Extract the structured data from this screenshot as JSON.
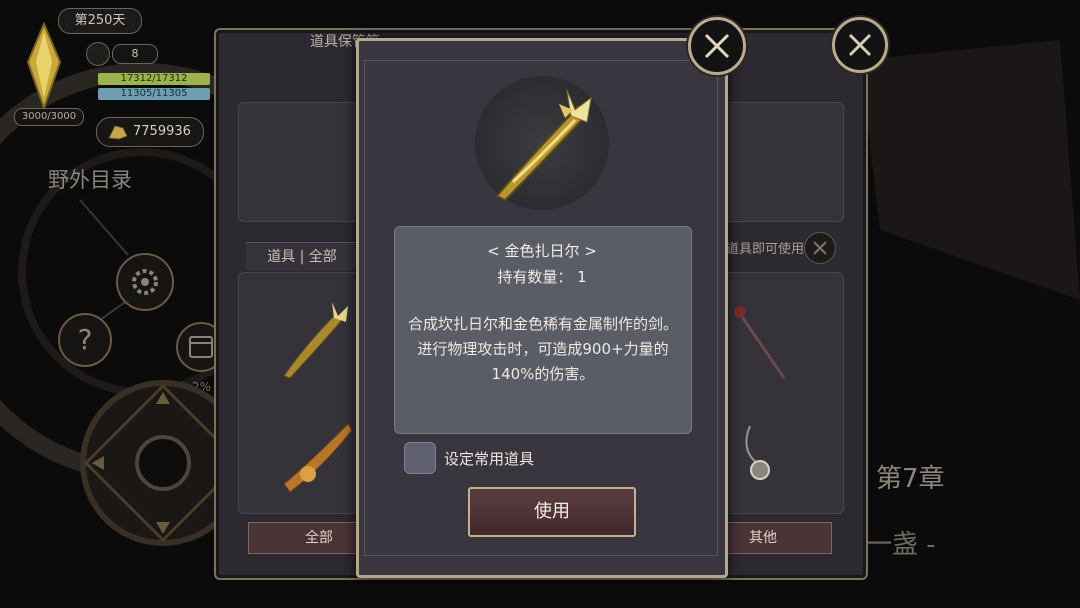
{
  "hud": {
    "day": "第250天",
    "calendar_count": "8",
    "hp": "17312/17312",
    "mp": "11305/11305",
    "stamina": "3000/3000",
    "gold": "7759936",
    "field_menu": "野外目录",
    "help": "?",
    "progress": "2%",
    "chapter": "第7章",
    "chapter_sub": "后一盏 -"
  },
  "storage": {
    "title": "道具保管箱",
    "filter_label": "道具 | 全部",
    "hint": "道具即可使用",
    "tabs": [
      "全部",
      "其他"
    ]
  },
  "item_detail": {
    "name": "< 金色扎日尔 >",
    "quantity": "持有数量： 1",
    "description": "合成坎扎日尔和金色稀有金属制作的剑。进行物理攻击时，可造成900+力量的140%的伤害。",
    "favorite_label": "设定常用道具",
    "use_button": "使用"
  },
  "colors": {
    "accent_gold": "#c3b08e",
    "hp_bar": "#9cb24a",
    "mp_bar": "#6f9fae",
    "button_red": "#4b3438"
  }
}
